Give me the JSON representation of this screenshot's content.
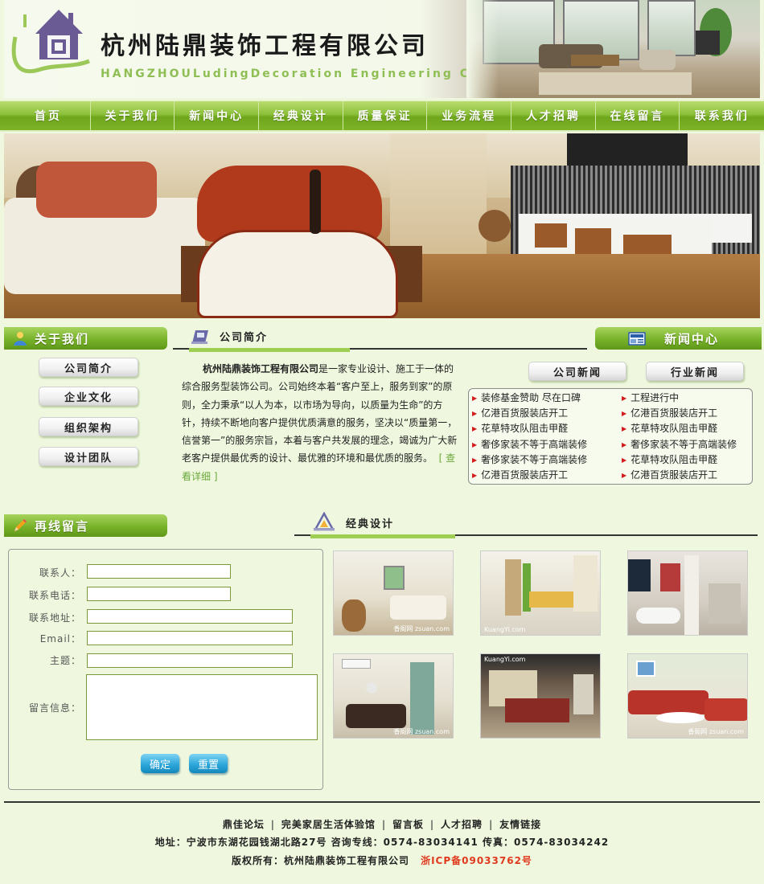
{
  "header": {
    "company_name": "杭州陆鼎装饰工程有限公司",
    "company_en": "HANGZHOULudingDecoration Engineering Co., Ltd"
  },
  "nav": [
    "首页",
    "关于我们",
    "新闻中心",
    "经典设计",
    "质量保证",
    "业务流程",
    "人才招聘",
    "在线留言",
    "联系我们"
  ],
  "about_sidebar": {
    "title": "关于我们",
    "items": [
      "公司简介",
      "企业文化",
      "组织架构",
      "设计团队"
    ]
  },
  "intro": {
    "title": "公司简介",
    "company": "杭州陆鼎装饰工程有限公司",
    "text": "是一家专业设计、施工于一体的综合服务型装饰公司。公司始终本着“客户至上，服务到家”的原则，全力秉承“以人为本，以市场为导向，以质量为生命”的方针，持续不断地向客户提供优质满意的服务，坚决以“质量第一，信誉第一”的服务宗旨，本着与客户共发展的理念，竭诚为广大新老客户提供最优秀的设计、最优雅的环境和最优质的服务。",
    "more": "[ 查看详细 ]"
  },
  "news": {
    "title": "新闻中心",
    "tabs": [
      "公司新闻",
      "行业新闻"
    ],
    "company_news": [
      "装修基金赞助 尽在口碑",
      "亿港百货服装店开工",
      "花草特攻队阻击甲醛",
      "奢侈家装不等于高端装修",
      "奢侈家装不等于高端装修",
      "亿港百货服装店开工"
    ],
    "industry_news": [
      "工程进行中",
      "亿港百货服装店开工",
      "花草特攻队阻击甲醛",
      "奢侈家装不等于高端装修",
      "花草特攻队阻击甲醛",
      "亿港百货服装店开工"
    ]
  },
  "message": {
    "title": "再线留言",
    "fields": {
      "contact": "联系人：",
      "phone": "联系电话：",
      "address": "联系地址：",
      "email": "Email：",
      "subject": "主题：",
      "message": "留言信息："
    },
    "submit": "确定",
    "reset": "重置"
  },
  "design": {
    "title": "经典设计",
    "watermarks": [
      "香阁网 zsuan.com",
      "KuangYi.com",
      "",
      "香阁网 zsuan.com",
      "KuangYi.com",
      "香阁网 zsuan.com"
    ]
  },
  "footer": {
    "links": [
      "鼎佳论坛",
      "完美家居生活体验馆",
      "留言板",
      "人才招聘",
      "友情链接"
    ],
    "address": "地址：宁波市东湖花园钱湖北路27号 咨询专线：0574-83034141 传真：0574-83034242",
    "copyright": "版权所有：杭州陆鼎装饰工程有限公司",
    "icp": "浙ICP备09033762号"
  },
  "colors": {
    "nav_green": "#78b22a",
    "page_bg": "#eff8df",
    "icp_red": "#e03a1e",
    "button_blue": "#2ea7da"
  }
}
